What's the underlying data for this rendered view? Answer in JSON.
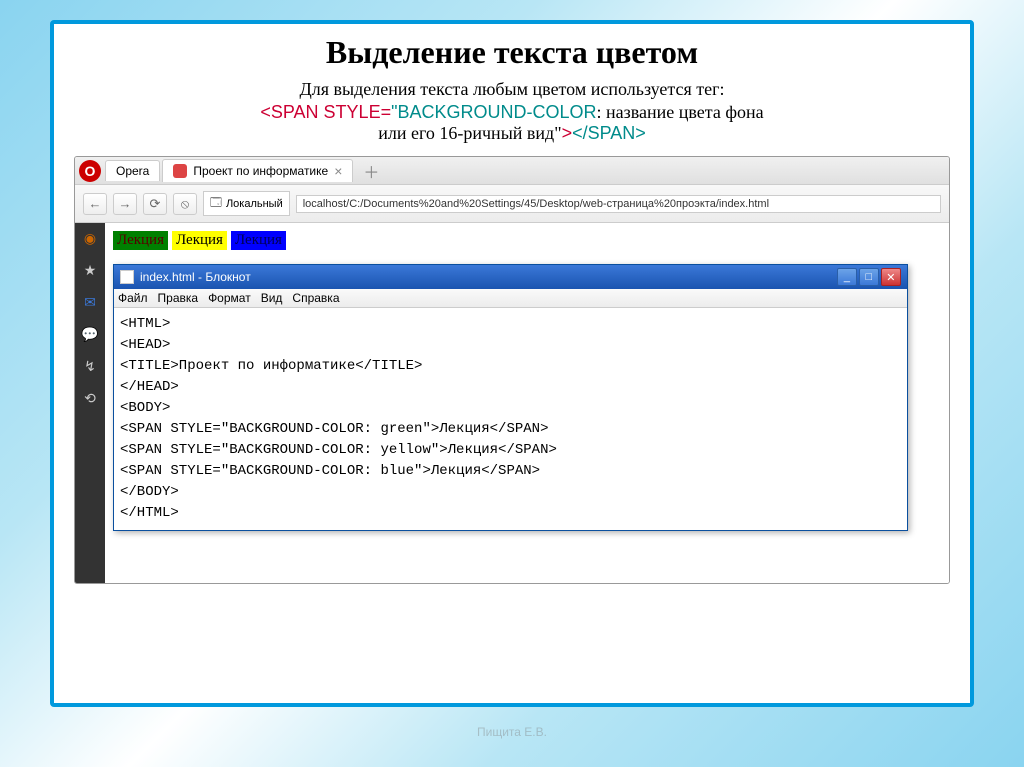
{
  "slide": {
    "title": "Выделение текста цветом",
    "subtitle_line1": "Для выделения текста любым цветом используется тег:",
    "tag_open_span": "<SPAN STYLE=",
    "tag_attr": "\"BACKGROUND-COLOR",
    "tag_desc": ": название цвета фона",
    "subtitle_line3a": "или его 16-ричный вид\"",
    "tag_gt": ">",
    "tag_close": "</SPAN>"
  },
  "browser": {
    "opera_label": "Opera",
    "tab_label": "Проект по информатике",
    "addr_local": "Локальный",
    "addr_url": "localhost/C:/Documents%20and%20Settings/45/Desktop/web-страница%20проэкта/index.html"
  },
  "spans": {
    "green": "Лекция",
    "yellow": "Лекция",
    "blue": "Лекция"
  },
  "notepad": {
    "title": "index.html - Блокнот",
    "menu": {
      "file": "Файл",
      "edit": "Правка",
      "format": "Формат",
      "view": "Вид",
      "help": "Справка"
    },
    "content": "<HTML>\n<HEAD>\n<TITLE>Проект по информатике</TITLE>\n</HEAD>\n<BODY>\n<SPAN STYLE=\"BACKGROUND-COLOR: green\">Лекция</SPAN>\n<SPAN STYLE=\"BACKGROUND-COLOR: yellow\">Лекция</SPAN>\n<SPAN STYLE=\"BACKGROUND-COLOR: blue\">Лекция</SPAN>\n</BODY>\n</HTML>"
  },
  "footer": "Пищита Е.В."
}
